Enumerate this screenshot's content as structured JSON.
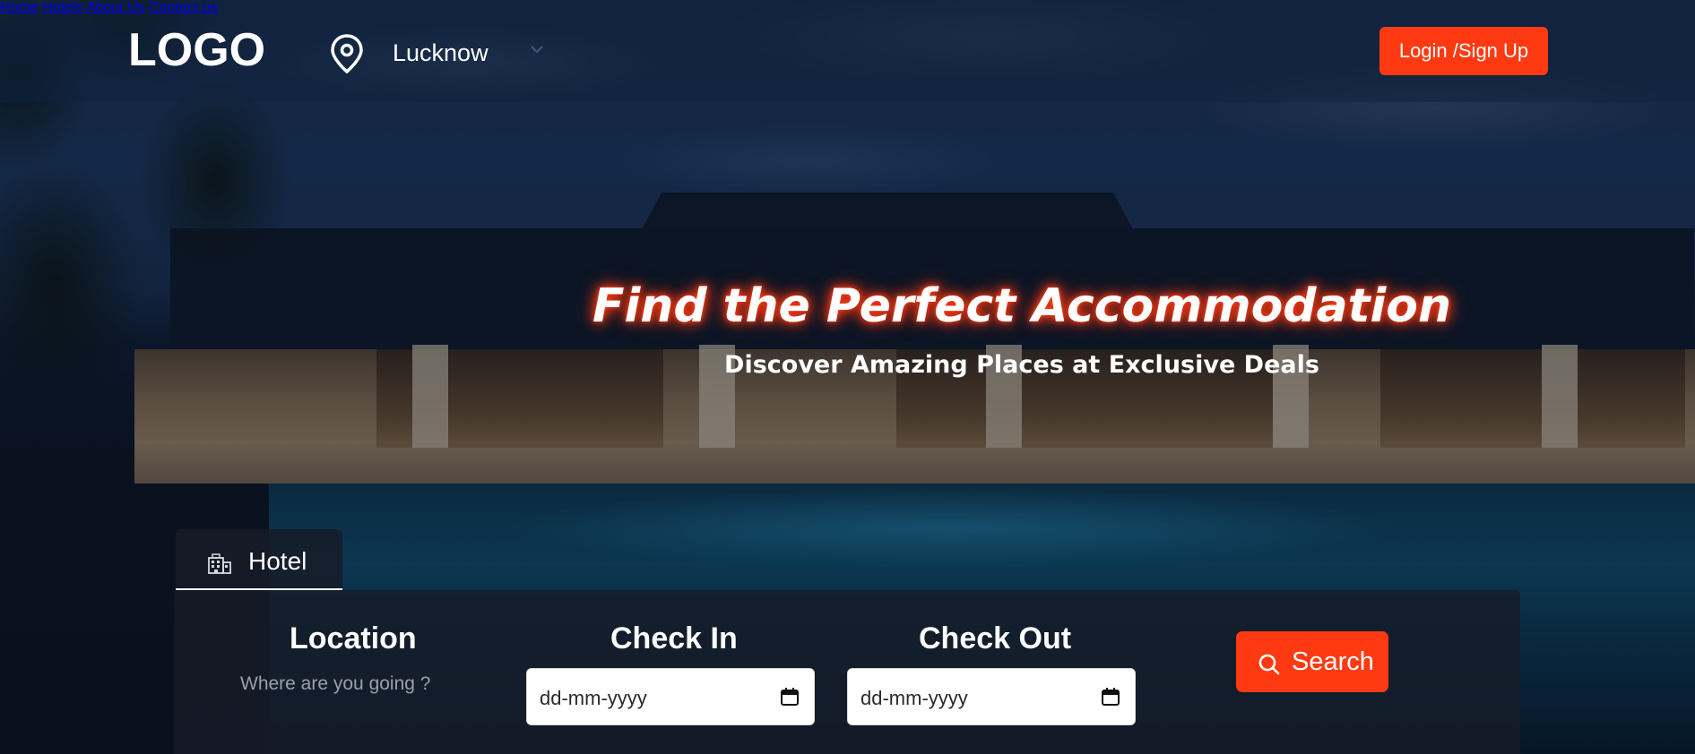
{
  "header": {
    "logo": "LOGO",
    "city": "Lucknow",
    "nav": [
      "Home",
      "Hotels",
      "About Us",
      "Contact us"
    ],
    "login_label": "Login /Sign Up"
  },
  "hero": {
    "title": "Find the Perfect Accommodation",
    "subtitle": "Discover Amazing Places at Exclusive Deals"
  },
  "tab": {
    "label": "Hotel",
    "icon": "building-icon"
  },
  "search": {
    "location_label": "Location",
    "location_placeholder": "Where are you going ?",
    "checkin_label": "Check In",
    "checkin_value": "dd-mm-yyyy",
    "checkout_label": "Check Out",
    "checkout_value": "dd-mm-yyyy",
    "button_label": "Search"
  },
  "colors": {
    "accent": "#ff3a12",
    "panel": "#161c28"
  }
}
